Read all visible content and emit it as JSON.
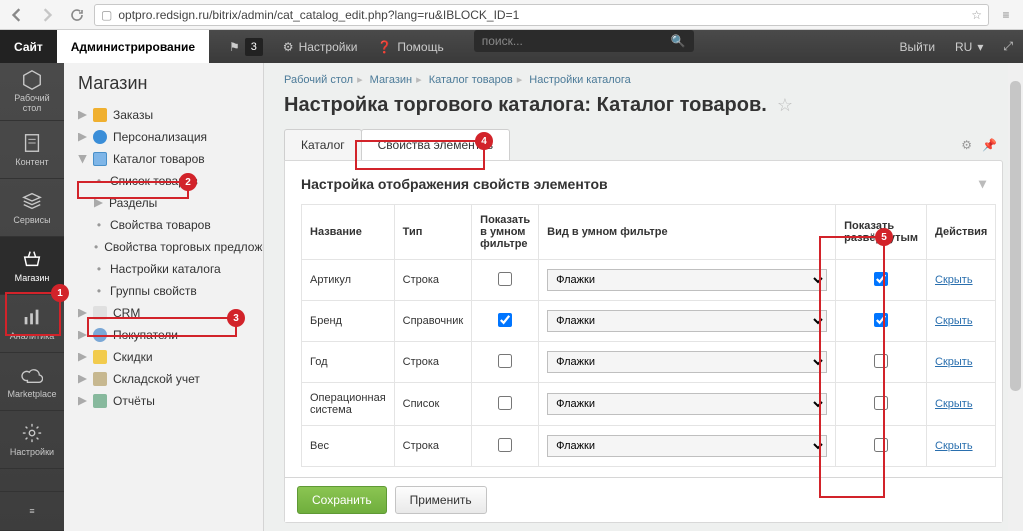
{
  "browser": {
    "url": "optpro.redsign.ru/bitrix/admin/cat_catalog_edit.php?lang=ru&IBLOCK_ID=1"
  },
  "topbar": {
    "site": "Сайт",
    "admin": "Администрирование",
    "notif_count": "3",
    "settings": "Настройки",
    "help": "Помощь",
    "search_placeholder": "поиск...",
    "logout": "Выйти",
    "lang": "RU"
  },
  "leftbar": [
    {
      "key": "desktop",
      "label": "Рабочий\nстол"
    },
    {
      "key": "content",
      "label": "Контент"
    },
    {
      "key": "services",
      "label": "Сервисы"
    },
    {
      "key": "shop",
      "label": "Магазин",
      "active": true
    },
    {
      "key": "analytics",
      "label": "Аналитика"
    },
    {
      "key": "marketplace",
      "label": "Marketplace"
    },
    {
      "key": "settings",
      "label": "Настройки"
    }
  ],
  "tree": {
    "title": "Магазин",
    "items": [
      {
        "kind": "orders",
        "label": "Заказы",
        "level": 1,
        "tw": "closed"
      },
      {
        "kind": "pers",
        "label": "Персонализация",
        "level": 1,
        "tw": "closed"
      },
      {
        "kind": "catalog",
        "label": "Каталог товаров",
        "level": 1,
        "tw": "open"
      },
      {
        "kind": "sub",
        "label": "Список товаров",
        "level": 2
      },
      {
        "kind": "sub",
        "label": "Разделы",
        "level": 2,
        "tw": "closed"
      },
      {
        "kind": "sub",
        "label": "Свойства товаров",
        "level": 2
      },
      {
        "kind": "sub",
        "label": "Свойства торговых предложений",
        "level": 2
      },
      {
        "kind": "sub",
        "label": "Настройки каталога",
        "level": 2
      },
      {
        "kind": "sub",
        "label": "Группы свойств",
        "level": 2
      },
      {
        "kind": "crm",
        "label": "CRM",
        "level": 1,
        "tw": "closed"
      },
      {
        "kind": "consumer",
        "label": "Покупатели",
        "level": 1,
        "tw": "closed"
      },
      {
        "kind": "discount",
        "label": "Скидки",
        "level": 1,
        "tw": "closed"
      },
      {
        "kind": "stock",
        "label": "Складской учет",
        "level": 1,
        "tw": "closed"
      },
      {
        "kind": "reports",
        "label": "Отчёты",
        "level": 1,
        "tw": "closed"
      }
    ]
  },
  "crumbs": [
    "Рабочий стол",
    "Магазин",
    "Каталог товаров",
    "Настройки каталога"
  ],
  "page_title": "Настройка торгового каталога: Каталог товаров.",
  "tabs": {
    "catalog": "Каталог",
    "props": "Свойства элементов"
  },
  "panel_title": "Настройка отображения свойств элементов",
  "table": {
    "headers": {
      "name": "Название",
      "type": "Тип",
      "smart_show": "Показать в умном фильтре",
      "smart_view": "Вид в умном фильтре",
      "expanded": "Показать развёрнутым",
      "actions": "Действия"
    },
    "rows": [
      {
        "name": "Артикул",
        "type": "Строка",
        "smart_show": false,
        "smart_view": "Флажки",
        "view_wide": false,
        "expanded": true,
        "action": "Скрыть"
      },
      {
        "name": "Бренд",
        "type": "Справочник",
        "smart_show": true,
        "smart_view": "Флажки",
        "view_wide": true,
        "expanded": true,
        "action": "Скрыть"
      },
      {
        "name": "Год",
        "type": "Строка",
        "smart_show": false,
        "smart_view": "Флажки",
        "view_wide": false,
        "expanded": false,
        "action": "Скрыть"
      },
      {
        "name": "Операционная система",
        "type": "Список",
        "smart_show": false,
        "smart_view": "Флажки",
        "view_wide": false,
        "expanded": false,
        "action": "Скрыть"
      },
      {
        "name": "Вес",
        "type": "Строка",
        "smart_show": false,
        "smart_view": "Флажки",
        "view_wide": false,
        "expanded": false,
        "action": "Скрыть"
      }
    ]
  },
  "buttons": {
    "save": "Сохранить",
    "apply": "Применить"
  },
  "annotations": {
    "1": "1",
    "2": "2",
    "3": "3",
    "4": "4",
    "5": "5"
  }
}
